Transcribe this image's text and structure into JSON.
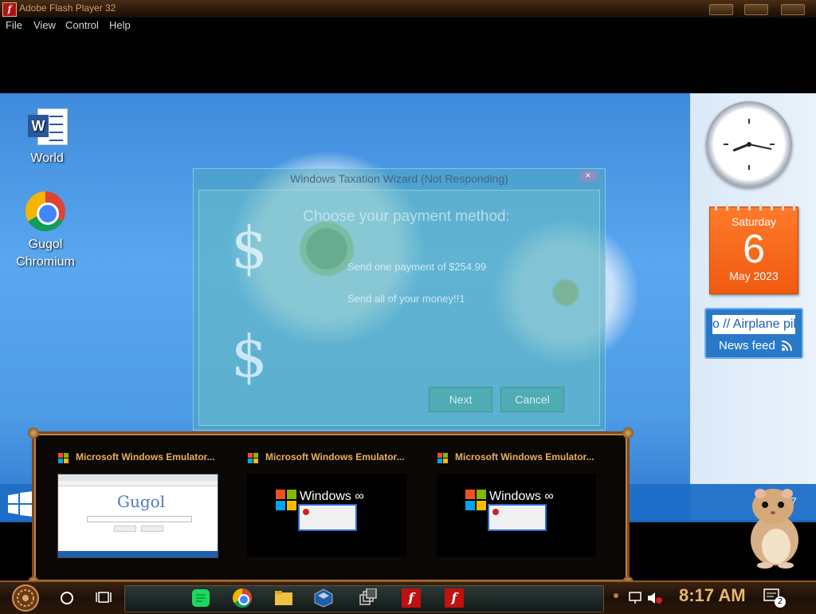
{
  "window": {
    "title": "Adobe Flash Player 32"
  },
  "menu": [
    "File",
    "View",
    "Control",
    "Help"
  ],
  "desktop_icons": [
    {
      "label": "World",
      "icon": "word-icon"
    },
    {
      "label": "Gugol\nChromium",
      "label_line1": "Gugol",
      "label_line2": "Chromium",
      "icon": "chromium-icon"
    }
  ],
  "wizard": {
    "title": "Windows Taxation Wizard (Not Responding)",
    "heading": "Choose your payment method:",
    "option1": "Send one payment of $254.99",
    "option2": "Send all of your money!!1",
    "next_label": "Next",
    "cancel_label": "Cancel",
    "close_glyph": "✕",
    "dollar_symbol": "$"
  },
  "clock_widget": {
    "hour": 8,
    "minute": 17
  },
  "calendar": {
    "weekday": "Saturday",
    "day": "6",
    "month_year": "May 2023"
  },
  "news": {
    "ticker": "o // Airplane pil",
    "label": "News feed"
  },
  "switcher": {
    "items": [
      {
        "caption": "Microsoft Windows Emulator...",
        "thumb": "gugol",
        "thumb_text": "Gugol"
      },
      {
        "caption": "Microsoft Windows Emulator...",
        "thumb": "windows",
        "thumb_text": "Windows ∞"
      },
      {
        "caption": "Microsoft Windows Emulator...",
        "thumb": "windows",
        "thumb_text": "Windows ∞"
      }
    ]
  },
  "taskbar": {
    "time": "8:17 AM",
    "notification_count": "2",
    "strip_edge_text": "7"
  },
  "colors": {
    "accent": "#e8b868",
    "desktop_blue": "#4e9be6",
    "calendar_orange": "#f05a10",
    "news_blue": "#2a78c8"
  }
}
